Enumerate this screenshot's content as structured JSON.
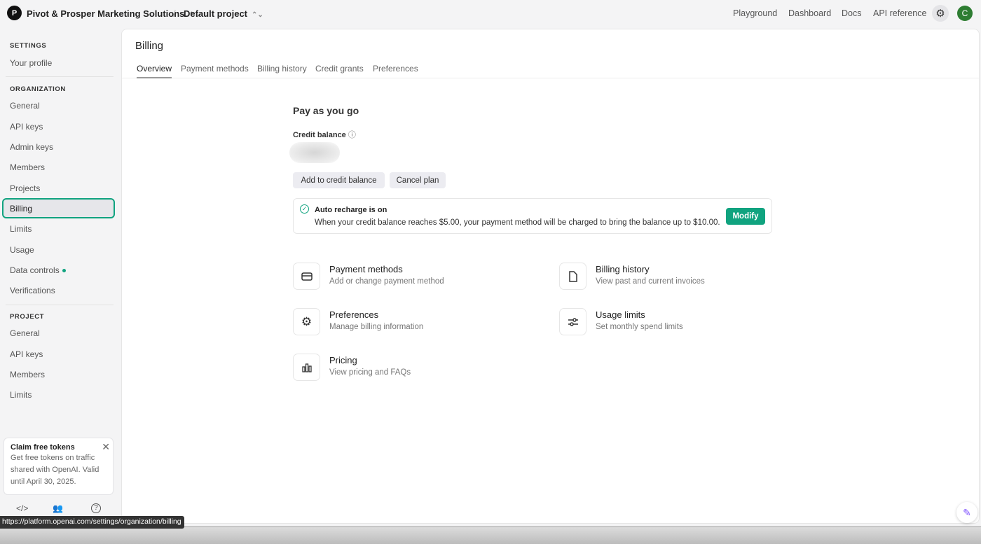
{
  "header": {
    "logo_letter": "P",
    "org": "Pivot & Prosper Marketing Solutions",
    "separator": "/",
    "project": "Default project",
    "nav": [
      "Playground",
      "Dashboard",
      "Docs",
      "API reference"
    ],
    "avatar": "C"
  },
  "sidebar": {
    "settings_heading": "SETTINGS",
    "your_profile": "Your profile",
    "org_heading": "ORGANIZATION",
    "org_items": [
      "General",
      "API keys",
      "Admin keys",
      "Members",
      "Projects",
      "Billing",
      "Limits",
      "Usage",
      "Data controls",
      "Verifications"
    ],
    "project_heading": "PROJECT",
    "project_items": [
      "General",
      "API keys",
      "Members",
      "Limits"
    ],
    "claim": {
      "title": "Claim free tokens",
      "text": "Get free tokens on traffic shared with OpenAI. Valid until April 30, 2025."
    }
  },
  "status_url": "https://platform.openai.com/settings/organization/billing",
  "main": {
    "title": "Billing",
    "tabs": [
      "Overview",
      "Payment methods",
      "Billing history",
      "Credit grants",
      "Preferences"
    ],
    "plan": "Pay as you go",
    "credit_label": "Credit balance",
    "add_credit": "Add to credit balance",
    "cancel": "Cancel plan",
    "recharge": {
      "title": "Auto recharge is on",
      "text": "When your credit balance reaches $5.00, your payment method will be charged to bring the balance up to $10.00.",
      "button": "Modify"
    },
    "links": [
      {
        "title": "Payment methods",
        "sub": "Add or change payment method"
      },
      {
        "title": "Billing history",
        "sub": "View past and current invoices"
      },
      {
        "title": "Preferences",
        "sub": "Manage billing information"
      },
      {
        "title": "Usage limits",
        "sub": "Set monthly spend limits"
      },
      {
        "title": "Pricing",
        "sub": "View pricing and FAQs"
      }
    ]
  },
  "colors": {
    "accent": "#10a37f"
  }
}
